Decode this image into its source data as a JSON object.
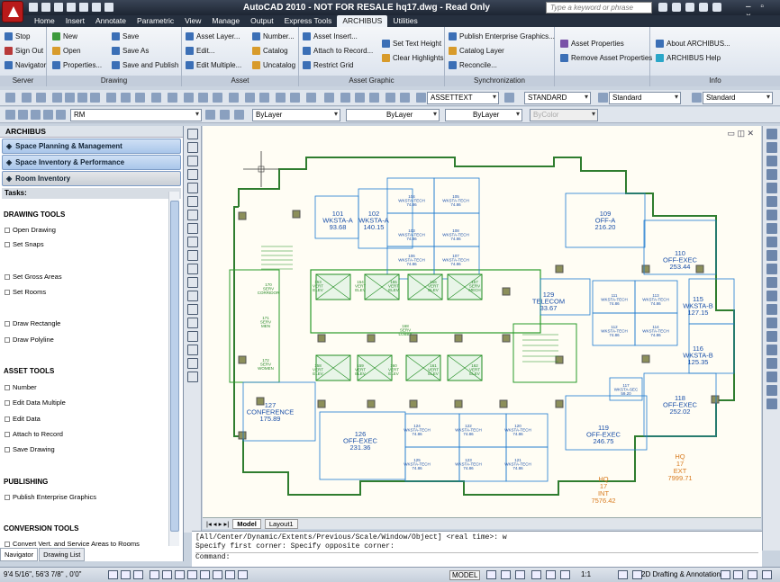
{
  "app": {
    "title": "AutoCAD 2010 - NOT FOR RESALE   hq17.dwg - Read Only",
    "search_placeholder": "Type a keyword or phrase",
    "window_controls": "– ▫ ×"
  },
  "tabs": [
    "Home",
    "Insert",
    "Annotate",
    "Parametric",
    "View",
    "Manage",
    "Output",
    "Express Tools",
    "ARCHIBUS",
    "Utilities"
  ],
  "active_tab": "ARCHIBUS",
  "ribbon": {
    "server": {
      "title": "Server",
      "items": [
        "Stop",
        "Sign Out",
        "Navigator"
      ]
    },
    "drawing": {
      "title": "Drawing",
      "items": [
        "New",
        "Open",
        "Properties...",
        "Save",
        "Save As",
        "Save and Publish"
      ]
    },
    "asset": {
      "title": "Asset",
      "items": [
        "Asset Layer...",
        "Edit...",
        "Edit Multiple...",
        "Number...",
        "Catalog",
        "Uncatalog"
      ]
    },
    "asset_graphic": {
      "title": "Asset Graphic",
      "items": [
        "Asset Insert...",
        "Attach to Record...",
        "Restrict Grid",
        "Set Text Height",
        "Clear Highlights"
      ]
    },
    "sync": {
      "title": "Synchronization",
      "items": [
        "Publish Enterprise Graphics...",
        "Catalog Layer",
        "Reconcile..."
      ]
    },
    "asset2": {
      "items": [
        "Asset Properties",
        "Remove Asset Properties"
      ]
    },
    "info": {
      "title": "Info",
      "items": [
        "About ARCHIBUS...",
        "ARCHIBUS Help"
      ]
    }
  },
  "toolbar": {
    "textstyle": "ASSETTEXT",
    "dimstyle": "STANDARD",
    "tablestyle": "Standard",
    "mleader": "Standard",
    "layer": "RM",
    "color": "ByLayer",
    "linetype": "ByLayer",
    "lineweight": "ByLayer",
    "plotstyle": "ByColor"
  },
  "left": {
    "title": "ARCHIBUS",
    "accordions": [
      "Space Planning & Management",
      "Space Inventory & Performance",
      "Room Inventory"
    ],
    "tasks_label": "Tasks:",
    "sections": {
      "drawing": "DRAWING TOOLS",
      "asset": "ASSET TOOLS",
      "publishing": "PUBLISHING",
      "conversion": "CONVERSION TOOLS"
    },
    "tasks": [
      "Open Drawing",
      "Set Snaps",
      "Set Gross Areas",
      "Set Rooms",
      "Draw Rectangle",
      "Draw Polyline",
      "Number",
      "Edit Data Multiple",
      "Edit Data",
      "Attach to Record",
      "Save Drawing",
      "Publish Enterprise Graphics",
      "Convert Vert. and Service Areas to Rooms"
    ],
    "bottom_tabs": [
      "Navigator",
      "Drawing List"
    ]
  },
  "layout_tabs": [
    "Model",
    "Layout1"
  ],
  "command": {
    "line1": "[All/Center/Dynamic/Extents/Previous/Scale/Window/Object] <real time>: w",
    "line2": "Specify first corner: Specify opposite corner:",
    "prompt": "Command:"
  },
  "status": {
    "coords": "9'4 5/16\",  56'3 7/8\" , 0'0\"",
    "model": "MODEL",
    "scale": "1:1",
    "workspace": "2D Drafting & Annotation"
  },
  "rooms": [
    {
      "id": "101",
      "type": "WKSTA-A",
      "area": "93.68"
    },
    {
      "id": "102",
      "type": "WKSTA-A",
      "area": "140.15"
    },
    {
      "id": "103",
      "type": "WKSTA-TECH",
      "area": "74.86"
    },
    {
      "id": "104",
      "type": "WKSTA-TECH",
      "area": "74.86"
    },
    {
      "id": "105",
      "type": "WKSTA-TECH",
      "area": "74.86"
    },
    {
      "id": "106",
      "type": "WKSTA-TECH",
      "area": "74.86"
    },
    {
      "id": "107",
      "type": "WKSTA-TECH",
      "area": "74.86"
    },
    {
      "id": "108",
      "type": "WKSTA-TECH",
      "area": "74.86"
    },
    {
      "id": "109",
      "type": "OFF-A",
      "area": "216.20"
    },
    {
      "id": "110",
      "type": "OFF-EXEC",
      "area": "253.44"
    },
    {
      "id": "111",
      "type": "WKSTA-TECH",
      "area": "74.86"
    },
    {
      "id": "112",
      "type": "WKSTA-TECH",
      "area": "74.86"
    },
    {
      "id": "113",
      "type": "WKSTA-TECH",
      "area": "74.86"
    },
    {
      "id": "114",
      "type": "WKSTA-TECH",
      "area": "74.86"
    },
    {
      "id": "115",
      "type": "WKSTA-B",
      "area": "127.15"
    },
    {
      "id": "116",
      "type": "WKSTA-B",
      "area": "125.35"
    },
    {
      "id": "117",
      "type": "WKSTA-SEC",
      "area": "59.20"
    },
    {
      "id": "118",
      "type": "OFF-EXEC",
      "area": "252.02"
    },
    {
      "id": "119",
      "type": "OFF-EXEC",
      "area": "246.75"
    },
    {
      "id": "120",
      "type": "WKSTA-TECH",
      "area": "74.86"
    },
    {
      "id": "121",
      "type": "WKSTA-TECH",
      "area": "74.86"
    },
    {
      "id": "122",
      "type": "WKSTA-TECH",
      "area": "74.86"
    },
    {
      "id": "123",
      "type": "WKSTA-TECH",
      "area": "74.86"
    },
    {
      "id": "124",
      "type": "WKSTA-TECH",
      "area": "74.86"
    },
    {
      "id": "125",
      "type": "WKSTA-TECH",
      "area": "74.86"
    },
    {
      "id": "126",
      "type": "OFF-EXEC",
      "area": "231.36"
    },
    {
      "id": "127",
      "type": "CONFERENCE",
      "area": "175.89"
    },
    {
      "id": "129",
      "type": "TELECOM",
      "area": "33.67"
    },
    {
      "id": "168",
      "type": "SERV",
      "area": "LOBBY"
    },
    {
      "id": "170",
      "type": "SERV",
      "area": "CORRIDOR"
    },
    {
      "id": "153",
      "type": "VERT",
      "area": "ELEV"
    },
    {
      "id": "154",
      "type": "VERT",
      "area": "ELEV"
    },
    {
      "id": "155",
      "type": "VERT",
      "area": "ELEV"
    },
    {
      "id": "156",
      "type": "VERT",
      "area": "ELEV"
    },
    {
      "id": "157",
      "type": "SERV",
      "area": "MECH"
    },
    {
      "id": "158",
      "type": "VERT",
      "area": "ELEV"
    },
    {
      "id": "159",
      "type": "VERT",
      "area": "ELEV"
    },
    {
      "id": "160",
      "type": "VERT",
      "area": "ELEV"
    },
    {
      "id": "161",
      "type": "VERT",
      "area": "ELEV"
    },
    {
      "id": "162",
      "type": "VERT",
      "area": "ELEV"
    },
    {
      "id": "171",
      "type": "SERV",
      "area": "MEN"
    },
    {
      "id": "172",
      "type": "SERV",
      "area": "WOMEN"
    }
  ],
  "totals": [
    {
      "label": "HQ",
      "floor": "17",
      "kind": "INT",
      "area": "7576.42"
    },
    {
      "label": "HQ",
      "floor": "17",
      "kind": "EXT",
      "area": "7999.71"
    }
  ]
}
